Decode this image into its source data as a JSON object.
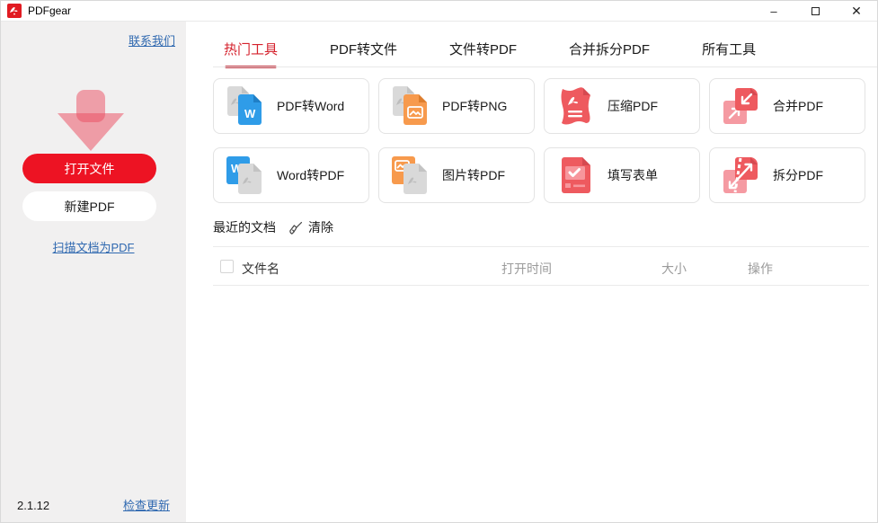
{
  "window": {
    "title": "PDFgear",
    "minimize_glyph": "–",
    "close_glyph": "✕"
  },
  "sidebar": {
    "contact_link": "联系我们",
    "open_file_button": "打开文件",
    "new_pdf_button": "新建PDF",
    "scan_link": "扫描文档为PDF",
    "version": "2.1.12",
    "check_update_link": "检查更新"
  },
  "tabs": [
    {
      "label": "热门工具",
      "active": true
    },
    {
      "label": "PDF转文件",
      "active": false
    },
    {
      "label": "文件转PDF",
      "active": false
    },
    {
      "label": "合并拆分PDF",
      "active": false
    },
    {
      "label": "所有工具",
      "active": false
    }
  ],
  "cards": [
    {
      "label": "PDF转Word",
      "icon": "pdf-to-word-icon"
    },
    {
      "label": "PDF转PNG",
      "icon": "pdf-to-png-icon"
    },
    {
      "label": "压缩PDF",
      "icon": "compress-pdf-icon"
    },
    {
      "label": "合并PDF",
      "icon": "merge-pdf-icon"
    },
    {
      "label": "Word转PDF",
      "icon": "word-to-pdf-icon"
    },
    {
      "label": "图片转PDF",
      "icon": "image-to-pdf-icon"
    },
    {
      "label": "填写表单",
      "icon": "fill-form-icon"
    },
    {
      "label": "拆分PDF",
      "icon": "split-pdf-icon"
    }
  ],
  "recent": {
    "title": "最近的文档",
    "clear_icon": "broom-icon",
    "clear_label": "清除",
    "columns": {
      "name": "文件名",
      "time": "打开时间",
      "size": "大小",
      "action": "操作"
    },
    "rows": []
  },
  "colors": {
    "accent_red": "#ed1323",
    "tab_red": "#d5222d",
    "link_blue": "#3069b0",
    "icon_red": "#ee5a5f",
    "icon_pink": "#f59aa2",
    "icon_blue": "#2f9ce8",
    "icon_orange": "#f79a4d",
    "icon_gray": "#d8d8d8",
    "sidebar_bg": "#f1f0f0"
  }
}
